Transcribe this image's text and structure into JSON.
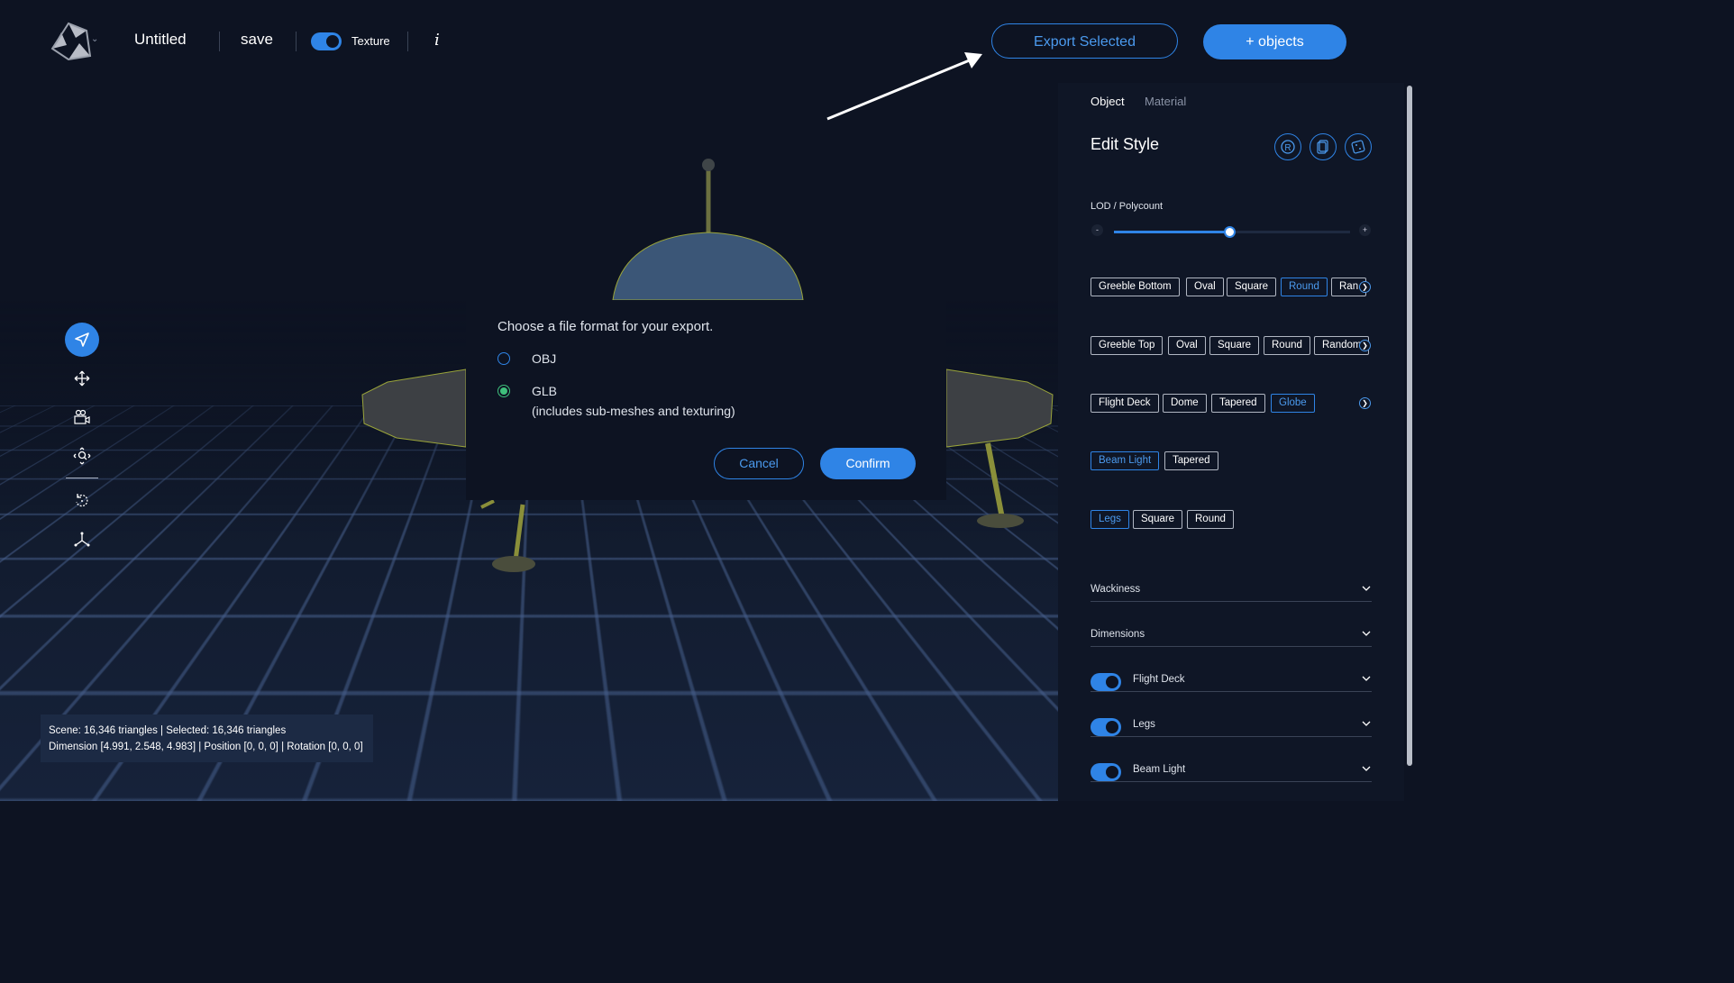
{
  "app": {
    "title": "Untitled",
    "save_label": "save",
    "texture_label": "Texture",
    "info_label": "i"
  },
  "header": {
    "export_label": "Export Selected",
    "objects_label": "+ objects"
  },
  "status": {
    "line1": "Scene: 16,346 triangles | Selected: 16,346 triangles",
    "line2": "Dimension [4.991, 2.548, 4.983] | Position [0, 0, 0] | Rotation [0, 0, 0]"
  },
  "dialog": {
    "title": "Choose a file format for your export.",
    "options": [
      {
        "label": "OBJ",
        "note": "",
        "checked": false
      },
      {
        "label": "GLB",
        "note": "(includes sub-meshes and texturing)",
        "checked": true
      }
    ],
    "cancel_label": "Cancel",
    "confirm_label": "Confirm"
  },
  "panel": {
    "tabs": [
      {
        "label": "Object",
        "active": true
      },
      {
        "label": "Material",
        "active": false
      }
    ],
    "heading": "Edit Style",
    "lod": {
      "label": "LOD / Polycount",
      "minus": "-",
      "plus": "+",
      "value_fraction": 0.49
    },
    "chip_rows": [
      [
        "Greeble Bottom",
        "Oval",
        "Square",
        "Round",
        "Ran"
      ],
      [
        "Greeble Top",
        "Oval",
        "Square",
        "Round",
        "Random"
      ],
      [
        "Flight Deck",
        "Dome",
        "Tapered",
        "Globe"
      ],
      [
        "Beam Light",
        "Tapered"
      ],
      [
        "Legs",
        "Square",
        "Round"
      ]
    ],
    "accordions": [
      "Wackiness",
      "Dimensions"
    ],
    "toggles": [
      "Flight Deck",
      "Legs",
      "Beam Light"
    ]
  },
  "colors": {
    "accent": "#2f84e6",
    "background": "#0d1322",
    "panel": "#0f1626",
    "radio_checked": "#3fc07c"
  }
}
